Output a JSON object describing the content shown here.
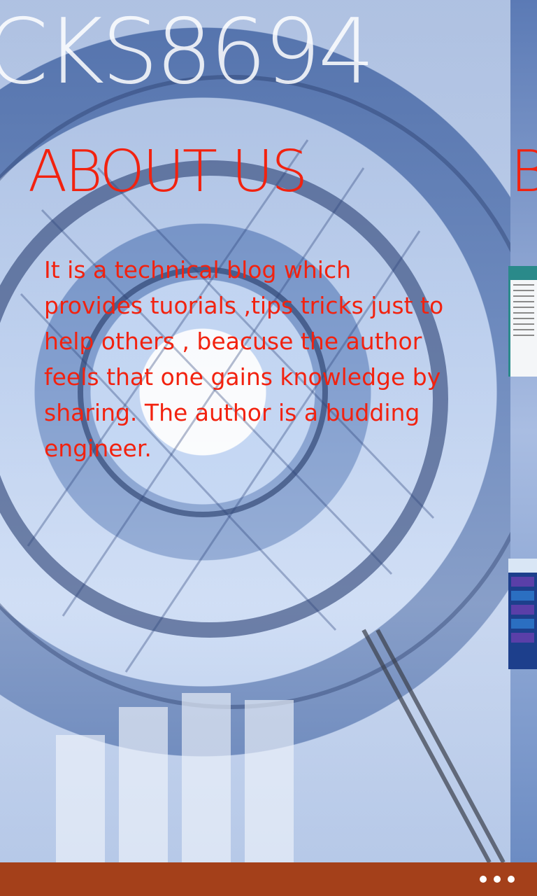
{
  "panorama": {
    "title": "CKS8694",
    "sections": [
      {
        "header": "ABOUT US",
        "body": "It is a technical blog which provides tuorials ,tips tricks just to help others , beacuse the author feels that one gains knowledge by sharing. The author is a budding engineer."
      },
      {
        "header": "B"
      }
    ]
  },
  "app_bar": {
    "more_icon": "ellipsis-icon"
  },
  "colors": {
    "accent": "#f2220f",
    "app_bar": "#a4401a"
  }
}
